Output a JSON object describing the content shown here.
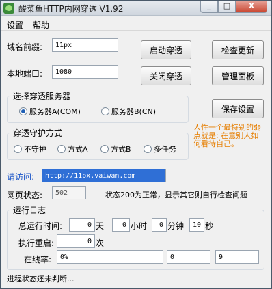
{
  "window": {
    "title": "酸菜鱼HTTP内网穿透 V1.92",
    "minimize": "_",
    "maximize": "□",
    "close": "X"
  },
  "menu": [
    "设置",
    "帮助"
  ],
  "domain": {
    "label": "域名前缀:",
    "value": "11px"
  },
  "port": {
    "label": "本地端口:",
    "value": "1080"
  },
  "buttons": {
    "start": "启动穿透",
    "check_update": "检查更新",
    "stop": "关闭穿透",
    "admin_panel": "管理面板",
    "save": "保存设置"
  },
  "server_group": {
    "title": "选择穿透服务器",
    "options": [
      {
        "label": "服务器A(COM)",
        "selected": true
      },
      {
        "label": "服务器B(CN)",
        "selected": false
      }
    ]
  },
  "guard_group": {
    "title": "穿透守护方式",
    "options": [
      {
        "label": "不守护",
        "selected": false
      },
      {
        "label": "方式A",
        "selected": false
      },
      {
        "label": "方式B",
        "selected": false
      },
      {
        "label": "多任务",
        "selected": false
      }
    ]
  },
  "note": "人性一个最特别的弱点就是: 在意别人如何看待自己。",
  "access": {
    "label": "请访问:",
    "url": "http://11px.vaiwan.com"
  },
  "page_status": {
    "label": "网页状态:",
    "value": "502",
    "hint": "状态200为正常，显示其它则自行检查问题"
  },
  "log_group": {
    "title": "运行日志",
    "total_time_label": "总运行时间:",
    "days": "0",
    "days_unit": "天",
    "hours": "0",
    "hours_unit": "小时",
    "minutes": "0",
    "minutes_unit": "分钟",
    "seconds": "10",
    "seconds_unit": "秒",
    "restart_label": "执行重启:",
    "restart_value": "0",
    "restart_unit": "次",
    "online_label": "在线率:",
    "online_rate": "0%",
    "count_a": "0",
    "count_b": "9"
  },
  "status_text": "进程状态还未判断..."
}
